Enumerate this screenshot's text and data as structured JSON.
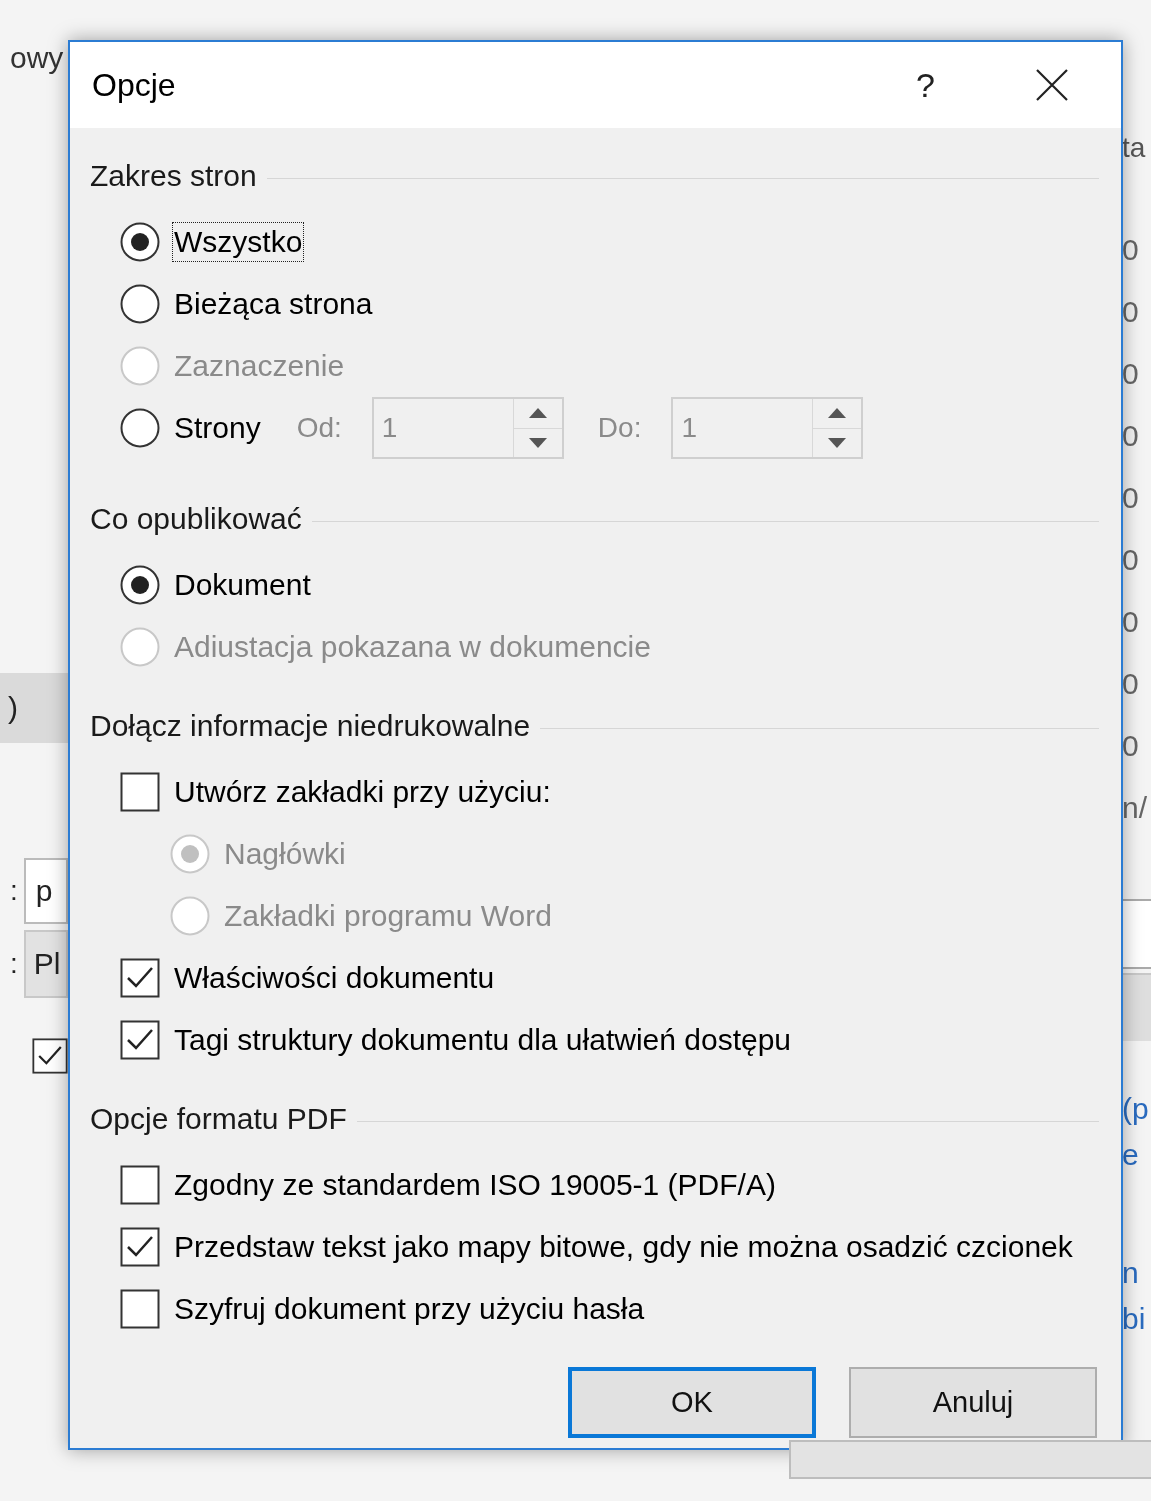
{
  "background": {
    "left_items": [
      {
        "kind": "text",
        "text": "owy"
      },
      {
        "kind": "band",
        "text": ")"
      },
      {
        "kind": "field",
        "label": ":",
        "value": "p"
      },
      {
        "kind": "dropdown",
        "label": ":",
        "value": "Pl"
      },
      {
        "kind": "checkbox",
        "checked": true
      }
    ],
    "right_items": [
      {
        "kind": "header",
        "text": "ta"
      },
      {
        "kind": "cell",
        "text": "0"
      },
      {
        "kind": "cell",
        "text": "0"
      },
      {
        "kind": "cell",
        "text": "0"
      },
      {
        "kind": "cell",
        "text": "0"
      },
      {
        "kind": "cell",
        "text": "0"
      },
      {
        "kind": "cell",
        "text": "0"
      },
      {
        "kind": "cell",
        "text": "0"
      },
      {
        "kind": "cell",
        "text": "0"
      },
      {
        "kind": "cell",
        "text": "0"
      },
      {
        "kind": "cell",
        "text": "n/"
      },
      {
        "kind": "field"
      },
      {
        "kind": "dropdown"
      },
      {
        "kind": "link",
        "text": "(p"
      },
      {
        "kind": "link",
        "text": "e"
      },
      {
        "kind": "link",
        "text": "n"
      },
      {
        "kind": "link",
        "text": "bi"
      },
      {
        "kind": "button"
      }
    ]
  },
  "dialog": {
    "title": "Opcje",
    "help": "?",
    "sections": [
      {
        "title": "Zakres stron",
        "items": [
          {
            "kind": "radio",
            "label": "Wszystko",
            "selected": true,
            "disabled": false,
            "focused": true
          },
          {
            "kind": "radio",
            "label": "Bieżąca strona",
            "selected": false,
            "disabled": false,
            "focused": false
          },
          {
            "kind": "radio",
            "label": "Zaznaczenie",
            "selected": false,
            "disabled": true,
            "focused": false
          },
          {
            "kind": "radio",
            "label": "Strony",
            "selected": false,
            "disabled": false,
            "focused": false,
            "range": [
              {
                "label": "Od:",
                "value": "1",
                "disabled": true
              },
              {
                "label": "Do:",
                "value": "1",
                "disabled": true
              }
            ]
          }
        ]
      },
      {
        "title": "Co opublikować",
        "items": [
          {
            "kind": "radio",
            "label": "Dokument",
            "selected": true,
            "disabled": false,
            "focused": false
          },
          {
            "kind": "radio",
            "label": "Adiustacja pokazana w dokumencie",
            "selected": false,
            "disabled": true,
            "focused": false
          }
        ]
      },
      {
        "title": "Dołącz informacje niedrukowalne",
        "items": [
          {
            "kind": "checkbox",
            "label": "Utwórz zakładki przy użyciu:",
            "checked": false,
            "disabled": false,
            "focused": false,
            "children": [
              {
                "kind": "radio",
                "label": "Nagłówki",
                "selected": true,
                "disabled": true,
                "focused": false
              },
              {
                "kind": "radio",
                "label": "Zakładki programu Word",
                "selected": false,
                "disabled": true,
                "focused": false
              }
            ]
          },
          {
            "kind": "checkbox",
            "label": "Właściwości dokumentu",
            "checked": true,
            "disabled": false,
            "focused": false
          },
          {
            "kind": "checkbox",
            "label": "Tagi struktury dokumentu dla ułatwień dostępu",
            "checked": true,
            "disabled": false,
            "focused": false
          }
        ]
      },
      {
        "title": "Opcje formatu PDF",
        "items": [
          {
            "kind": "checkbox",
            "label": "Zgodny ze standardem ISO 19005-1 (PDF/A)",
            "checked": false,
            "disabled": false,
            "focused": false
          },
          {
            "kind": "checkbox",
            "label": "Przedstaw tekst jako mapy bitowe, gdy nie można osadzić czcionek",
            "checked": true,
            "disabled": false,
            "focused": false
          },
          {
            "kind": "checkbox",
            "label": "Szyfruj dokument przy użyciu hasła",
            "checked": false,
            "disabled": false,
            "focused": false
          }
        ]
      }
    ],
    "buttons": [
      {
        "label": "OK",
        "default": true
      },
      {
        "label": "Anuluj",
        "default": false
      }
    ]
  }
}
